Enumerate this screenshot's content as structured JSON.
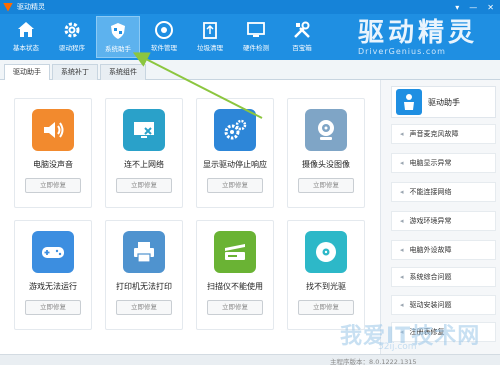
{
  "window": {
    "title": "驱动精灵",
    "minimize": "▾",
    "maximize": "—",
    "close": "✕"
  },
  "toolbar": {
    "items": [
      {
        "label": "基本状态",
        "icon": "home-icon"
      },
      {
        "label": "驱动程序",
        "icon": "gear-icon"
      },
      {
        "label": "系统助手",
        "icon": "shield-icon"
      },
      {
        "label": "软件管理",
        "icon": "disc-icon"
      },
      {
        "label": "垃圾清理",
        "icon": "recycle-bin-icon"
      },
      {
        "label": "硬件检测",
        "icon": "monitor-icon"
      },
      {
        "label": "百宝箱",
        "icon": "tools-icon"
      }
    ],
    "active_index": 2
  },
  "brand": {
    "name": "驱动精灵",
    "domain": "DriverGenius.com"
  },
  "tabs": [
    {
      "label": "驱动助手"
    },
    {
      "label": "系统补丁"
    },
    {
      "label": "系统组件"
    }
  ],
  "cards": [
    {
      "name": "电脑没声音",
      "icon": "speaker-icon",
      "color": "#f28a2e",
      "button": "立即修复"
    },
    {
      "name": "连不上网络",
      "icon": "network-monitor-icon",
      "color": "#2aa1c9",
      "button": "立即修复"
    },
    {
      "name": "显示驱动停止响应",
      "icon": "gears-icon",
      "color": "#2d86d8",
      "button": "立即修复"
    },
    {
      "name": "摄像头没图像",
      "icon": "webcam-icon",
      "color": "#7fa5c6",
      "button": "立即修复"
    },
    {
      "name": "游戏无法运行",
      "icon": "gamepad-icon",
      "color": "#3c8ee0",
      "button": "立即修复"
    },
    {
      "name": "打印机无法打印",
      "icon": "printer-icon",
      "color": "#4f93cf",
      "button": "立即修复"
    },
    {
      "name": "扫描仪不能使用",
      "icon": "scanner-icon",
      "color": "#6ab334",
      "button": "立即修复"
    },
    {
      "name": "找不到光驱",
      "icon": "optical-disc-icon",
      "color": "#2db8c8",
      "button": "立即修复"
    }
  ],
  "side": {
    "title": "驱动助手",
    "items": [
      "声音麦克风故障",
      "电脑显示异常",
      "不能连接网络",
      "游戏环境异常",
      "电脑外设故障",
      "系统综合问题",
      "驱动安装问题",
      "注册表修复"
    ]
  },
  "footer": {
    "version": "主程序版本：8.0.1222.1315"
  },
  "watermark": {
    "text": "我爱IT技术网",
    "url": "52ij.com"
  },
  "colors": {
    "toolbar": "#1f8fe2",
    "titlebar": "#1683d8",
    "arrow": "#8cc63f"
  }
}
